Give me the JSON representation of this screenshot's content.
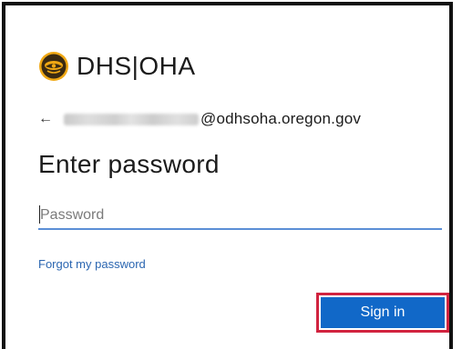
{
  "brand": {
    "name": "DHS|OHA",
    "logo_icon": "oregon-seal-icon",
    "logo_color": "#f0a814"
  },
  "identity": {
    "back_icon": "back-arrow-icon",
    "back_glyph": "←",
    "email_domain": "@odhsoha.oregon.gov"
  },
  "form": {
    "title": "Enter password",
    "password_placeholder": "Password",
    "forgot_link": "Forgot my password",
    "signin_label": "Sign in"
  },
  "colors": {
    "accent": "#1168c8",
    "link": "#2b66b1",
    "input_underline": "#5b8fd6",
    "highlight": "#d1233f"
  }
}
